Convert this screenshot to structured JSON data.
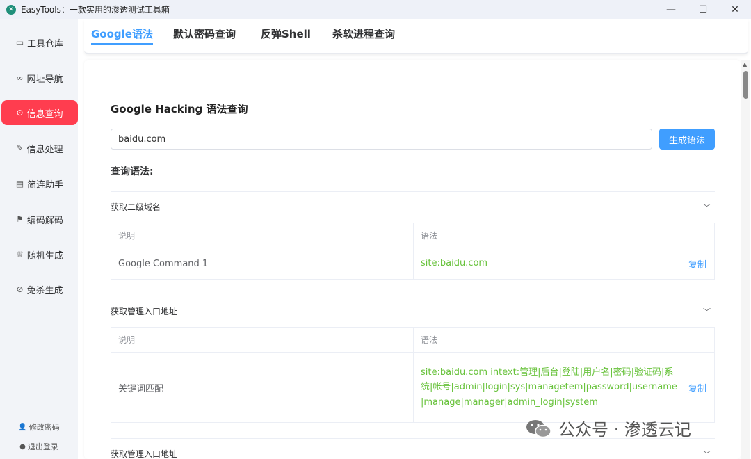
{
  "window": {
    "title": "EasyTools：一款实用的渗透测试工具箱",
    "controls": [
      "—",
      "☐",
      "✕"
    ]
  },
  "sidebar": {
    "items": [
      {
        "icon": "toolbox-icon",
        "glyph": "▭",
        "label": "工具仓库"
      },
      {
        "icon": "link-icon",
        "glyph": "∞",
        "label": "网址导航"
      },
      {
        "icon": "search-doc-icon",
        "glyph": "⊙",
        "label": "信息查询"
      },
      {
        "icon": "edit-icon",
        "glyph": "✎",
        "label": "信息处理"
      },
      {
        "icon": "news-icon",
        "glyph": "▤",
        "label": "简连助手"
      },
      {
        "icon": "flag-icon",
        "glyph": "⚑",
        "label": "编码解码"
      },
      {
        "icon": "trophy-icon",
        "glyph": "♕",
        "label": "随机生成"
      },
      {
        "icon": "pill-icon",
        "glyph": "⊘",
        "label": "免杀生成"
      }
    ],
    "active_index": 2,
    "change_password": "修改密码",
    "logout": "退出登录"
  },
  "tabs": [
    {
      "label": "Google语法"
    },
    {
      "label": "默认密码查询"
    },
    {
      "label": "反弹Shell"
    },
    {
      "label": "杀软进程查询"
    }
  ],
  "main": {
    "section_title": "Google Hacking 语法查询",
    "search_value": "baidu.com",
    "generate_button": "生成语法",
    "query_label": "查询语法:",
    "groups": [
      {
        "title": "获取二级域名",
        "col_desc": "说明",
        "col_syntax": "语法",
        "rows": [
          {
            "desc": "Google Command 1",
            "syntax": "site:baidu.com",
            "copy": "复制"
          }
        ]
      },
      {
        "title": "获取管理入口地址",
        "col_desc": "说明",
        "col_syntax": "语法",
        "rows": [
          {
            "desc": "关键词匹配",
            "syntax": "site:baidu.com intext:管理|后台|登陆|用户名|密码|验证码|系统|帐号|admin|login|sys|managetem|password|username|manage|manager|admin_login|system",
            "copy": "复制"
          }
        ]
      },
      {
        "title": "获取管理入口地址"
      }
    ]
  },
  "watermark": "公众号 · 渗透云记"
}
